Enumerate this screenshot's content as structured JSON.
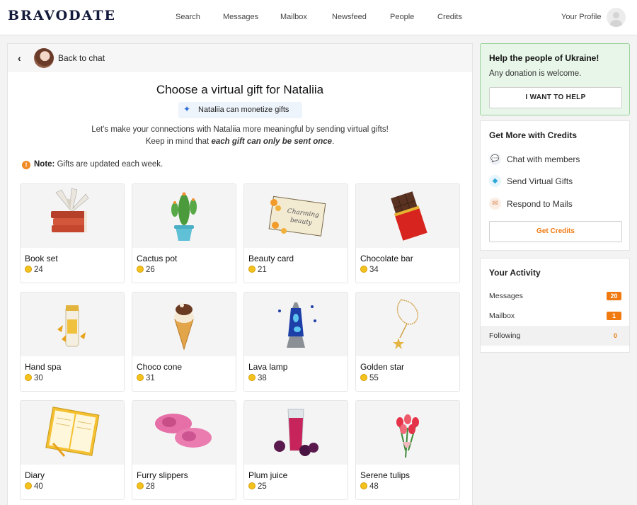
{
  "header": {
    "logo": "BRAVODATE",
    "nav": [
      "Search",
      "Messages",
      "Mailbox",
      "Newsfeed",
      "People",
      "Credits"
    ],
    "profile_label": "Your Profile"
  },
  "back": {
    "label": "Back to chat"
  },
  "main": {
    "title": "Choose a virtual gift for Nataliia",
    "monetize_label": "Nataliia can monetize gifts",
    "intro_1": "Let's make your connections with Nataliia more meaningful by sending virtual gifts! Keep in mind that ",
    "intro_em": "each gift can only be sent once",
    "intro_2": ".",
    "note_label": "Note:",
    "note_text": " Gifts are updated each week."
  },
  "gifts": [
    {
      "name": "Book set",
      "price": "24",
      "icon": "book-set"
    },
    {
      "name": "Cactus pot",
      "price": "26",
      "icon": "cactus-pot"
    },
    {
      "name": "Beauty card",
      "price": "21",
      "icon": "beauty-card"
    },
    {
      "name": "Chocolate bar",
      "price": "34",
      "icon": "chocolate-bar"
    },
    {
      "name": "Hand spa",
      "price": "30",
      "icon": "hand-spa"
    },
    {
      "name": "Choco cone",
      "price": "31",
      "icon": "choco-cone"
    },
    {
      "name": "Lava lamp",
      "price": "38",
      "icon": "lava-lamp"
    },
    {
      "name": "Golden star",
      "price": "55",
      "icon": "golden-star"
    },
    {
      "name": "Diary",
      "price": "40",
      "icon": "diary"
    },
    {
      "name": "Furry slippers",
      "price": "28",
      "icon": "furry-slippers"
    },
    {
      "name": "Plum juice",
      "price": "25",
      "icon": "plum-juice"
    },
    {
      "name": "Serene tulips",
      "price": "48",
      "icon": "serene-tulips"
    }
  ],
  "beauty_card_text": [
    "Charming",
    "beauty"
  ],
  "help": {
    "title": "Help the people of Ukraine!",
    "subtitle": "Any donation is welcome.",
    "button": "I WANT TO HELP"
  },
  "credits_panel": {
    "title": "Get More with Credits",
    "items": [
      {
        "label": "Chat with members",
        "icon": "chat-icon"
      },
      {
        "label": "Send Virtual Gifts",
        "icon": "diamond-icon"
      },
      {
        "label": "Respond to Mails",
        "icon": "envelope-icon"
      }
    ],
    "button": "Get Credits"
  },
  "activity": {
    "title": "Your Activity",
    "rows": [
      {
        "label": "Messages",
        "count": "20"
      },
      {
        "label": "Mailbox",
        "count": "1"
      },
      {
        "label": "Following",
        "count": "0"
      }
    ]
  },
  "colors": {
    "accent": "#f07a10",
    "logo": "#141a3a",
    "help_bg": "#e8f6e9",
    "help_border": "#9ad39c",
    "coin": "#f4c21d"
  }
}
